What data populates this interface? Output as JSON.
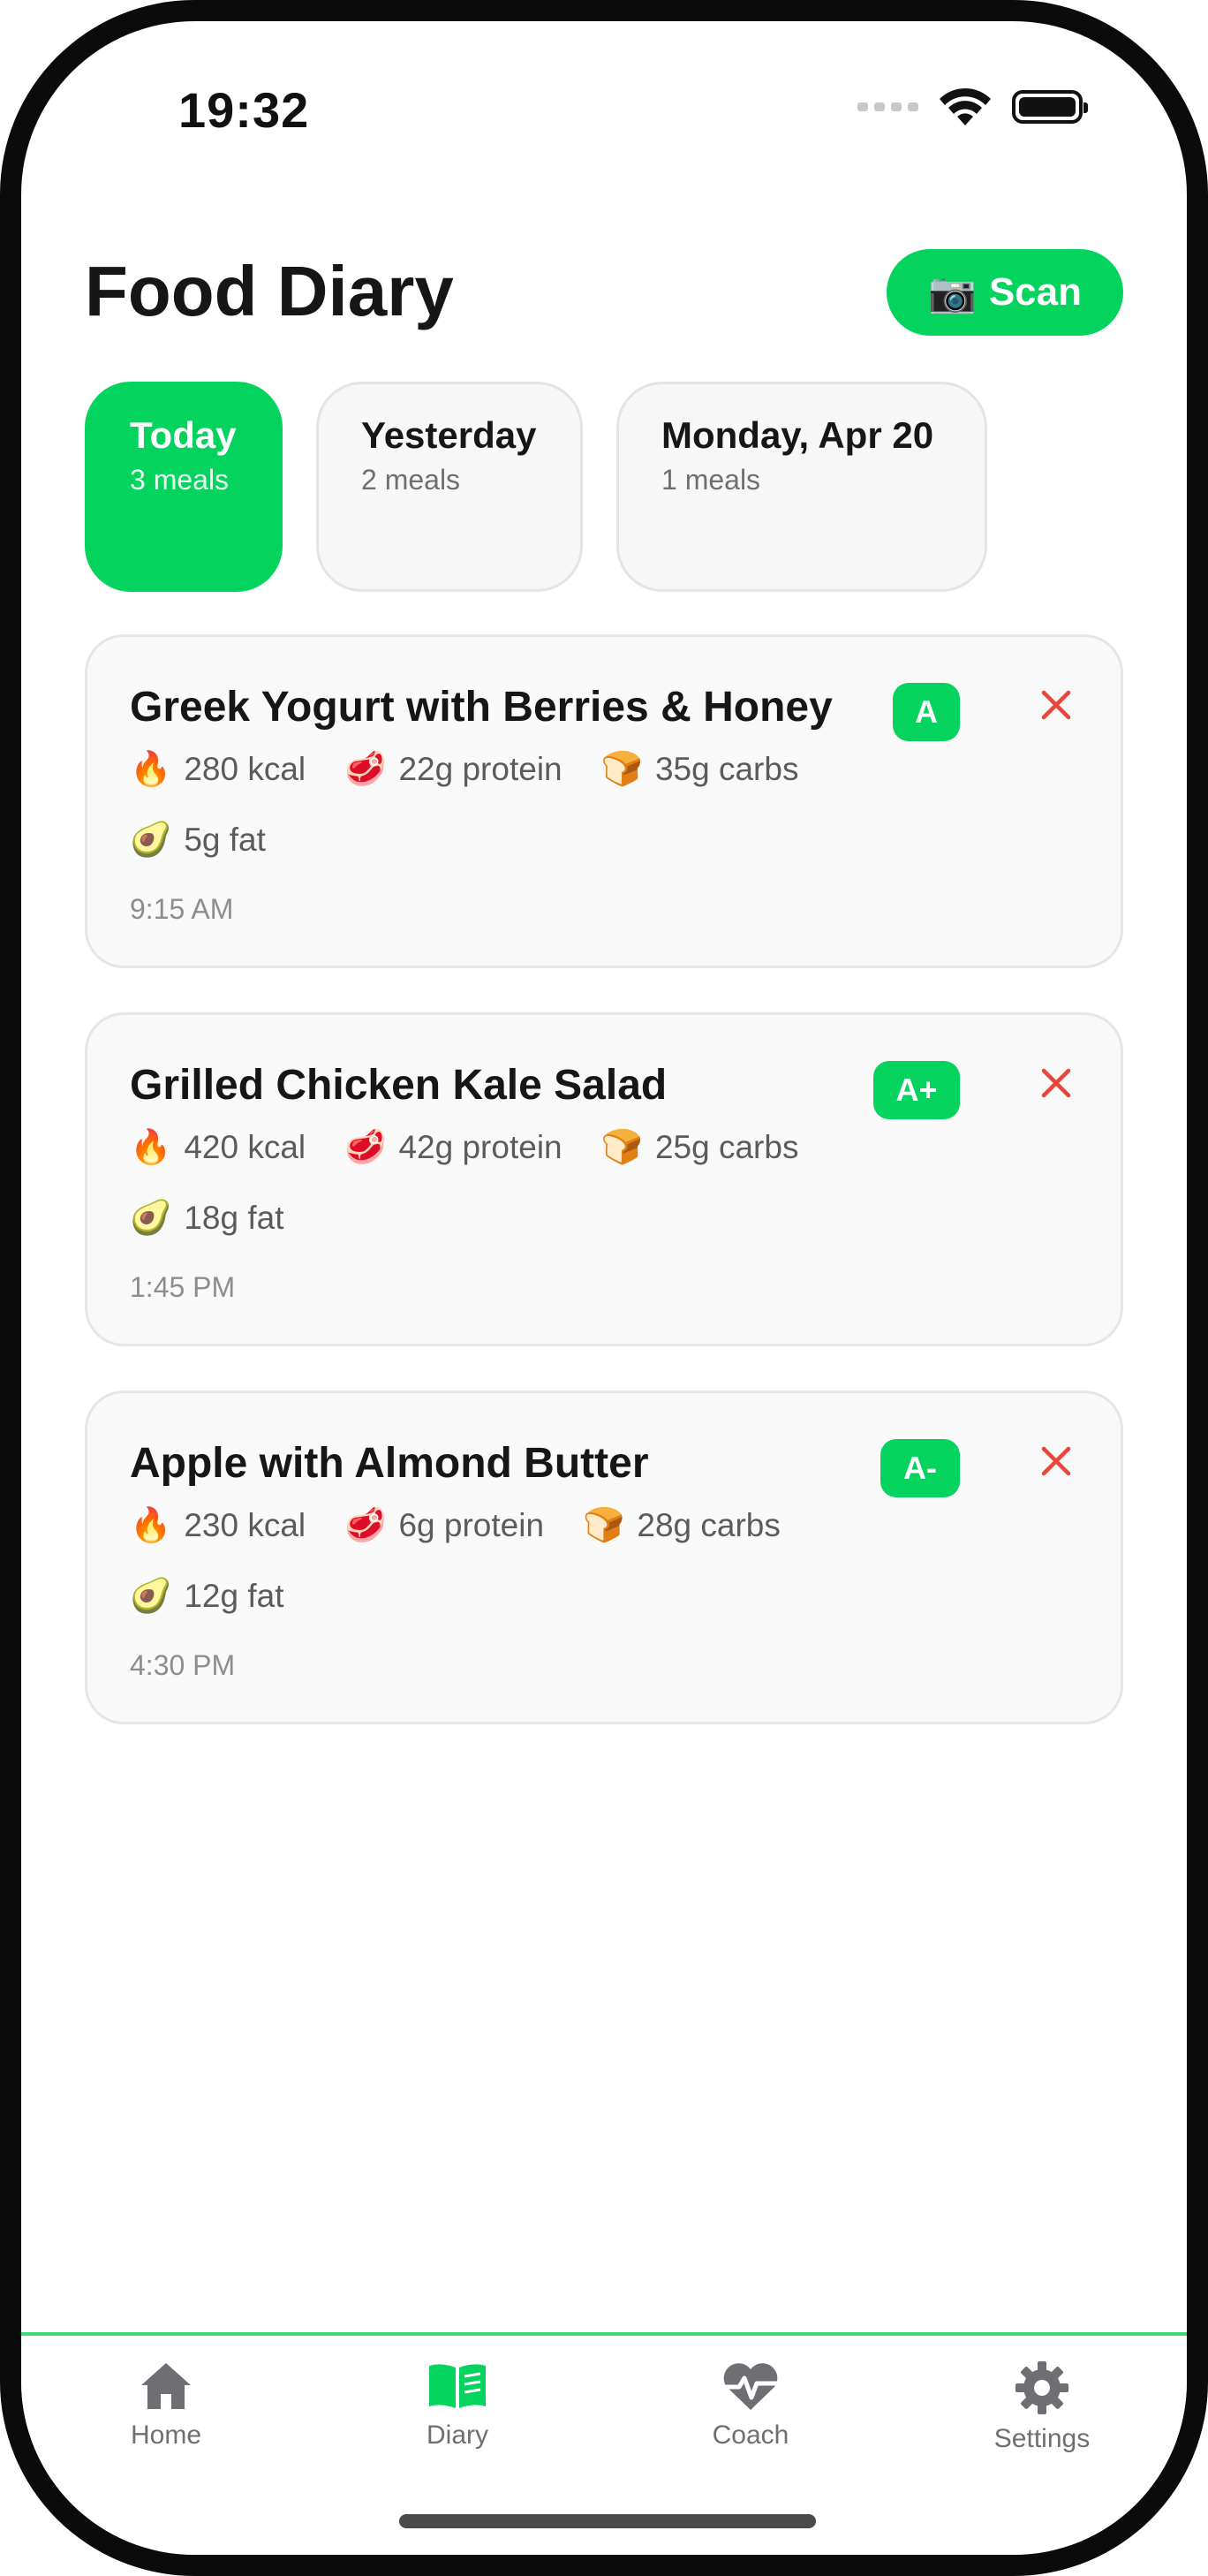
{
  "status_bar": {
    "time": "19:32"
  },
  "header": {
    "title": "Food Diary",
    "scan_label": "Scan",
    "scan_icon": "camera-emoji"
  },
  "day_tabs": [
    {
      "label": "Today",
      "sub": "3 meals",
      "active": true
    },
    {
      "label": "Yesterday",
      "sub": "2 meals",
      "active": false
    },
    {
      "label": "Monday, Apr 20",
      "sub": "1 meals",
      "active": false
    }
  ],
  "meals": [
    {
      "name": "Greek Yogurt with Berries & Honey",
      "grade": "A",
      "kcal": "280 kcal",
      "protein": "22g protein",
      "carbs": "35g carbs",
      "fat": "5g fat",
      "time": "9:15 AM"
    },
    {
      "name": "Grilled Chicken Kale Salad",
      "grade": "A+",
      "kcal": "420 kcal",
      "protein": "42g protein",
      "carbs": "25g carbs",
      "fat": "18g fat",
      "time": "1:45 PM"
    },
    {
      "name": "Apple with Almond Butter",
      "grade": "A-",
      "kcal": "230 kcal",
      "protein": "6g protein",
      "carbs": "28g carbs",
      "fat": "12g fat",
      "time": "4:30 PM"
    }
  ],
  "tab_bar": {
    "items": [
      {
        "label": "Home",
        "icon": "house-icon",
        "active": false
      },
      {
        "label": "Diary",
        "icon": "book-icon",
        "active": true
      },
      {
        "label": "Coach",
        "icon": "heart-pulse-icon",
        "active": false
      },
      {
        "label": "Settings",
        "icon": "gear-icon",
        "active": false
      }
    ]
  },
  "colors": {
    "accent": "#04d35d",
    "delete": "#e8463a",
    "inactive_icon": "#6e6e73"
  }
}
